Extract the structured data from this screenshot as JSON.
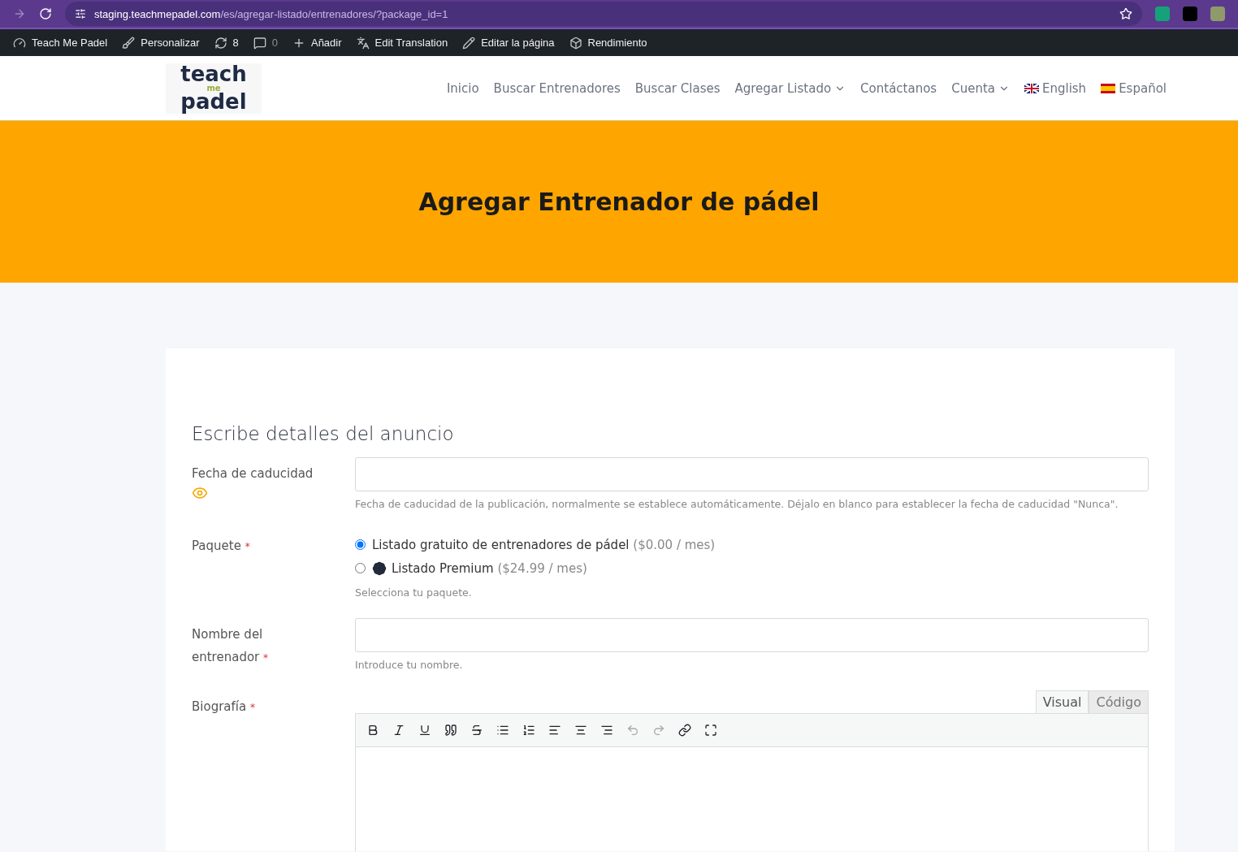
{
  "browser": {
    "url_host": "staging.teachmepadel.com",
    "url_path": "/es/agregar-listado/entrenadores/?package_id=1"
  },
  "admin_bar": [
    {
      "kind": "dashboard",
      "label": "Teach Me Padel"
    },
    {
      "kind": "brush",
      "label": "Personalizar"
    },
    {
      "kind": "updates",
      "label": "8"
    },
    {
      "kind": "comments",
      "label": "0"
    },
    {
      "kind": "add",
      "label": "Añadir"
    },
    {
      "kind": "translate",
      "label": "Edit Translation"
    },
    {
      "kind": "edit",
      "label": "Editar la página"
    },
    {
      "kind": "performance",
      "label": "Rendimiento"
    }
  ],
  "logo": {
    "top": "teach",
    "middle": "me",
    "bottom": "padel"
  },
  "nav": [
    {
      "kind": "link",
      "label": "Inicio",
      "dropdown": false
    },
    {
      "kind": "link",
      "label": "Buscar Entrenadores",
      "dropdown": false
    },
    {
      "kind": "link",
      "label": "Buscar Clases",
      "dropdown": false
    },
    {
      "kind": "link",
      "label": "Agregar Listado",
      "dropdown": true
    },
    {
      "kind": "link",
      "label": "Contáctanos",
      "dropdown": false
    },
    {
      "kind": "link",
      "label": "Cuenta",
      "dropdown": true
    },
    {
      "kind": "uk",
      "label": "English",
      "dropdown": false
    },
    {
      "kind": "es",
      "label": "Español",
      "dropdown": false
    }
  ],
  "hero": {
    "title": "Agregar Entrenador de pádel"
  },
  "form": {
    "title": "Escribe detalles del anuncio",
    "expiry": {
      "label": "Fecha de caducidad",
      "help": "Fecha de caducidad de la publicación, normalmente se establece automáticamente. Déjalo en blanco para establecer la fecha de caducidad \"Nunca\"."
    },
    "package": {
      "label": "Paquete",
      "required_mark": "*",
      "options": [
        {
          "name": "Listado gratuito de entrenadores de pádel",
          "price": "($0.00 / mes)",
          "selected": true,
          "badge": false
        },
        {
          "name": "Listado Premium",
          "price": "($24.99 / mes)",
          "selected": false,
          "badge": true
        }
      ],
      "help": "Selecciona tu paquete."
    },
    "name": {
      "label_1": "Nombre del",
      "label_2": "entrenador",
      "required_mark": "*",
      "help": "Introduce tu nombre."
    },
    "bio": {
      "label": "Biografía",
      "required_mark": "*",
      "tabs": [
        {
          "label": "Visual",
          "selected": true
        },
        {
          "label": "Código",
          "selected": false
        }
      ],
      "tools": [
        {
          "kind": "bold",
          "disabled": false
        },
        {
          "kind": "italic",
          "disabled": false
        },
        {
          "kind": "underline",
          "disabled": false
        },
        {
          "kind": "quote",
          "disabled": false
        },
        {
          "kind": "strike",
          "disabled": false
        },
        {
          "kind": "bullets",
          "disabled": false
        },
        {
          "kind": "numbers",
          "disabled": false
        },
        {
          "kind": "left",
          "disabled": false
        },
        {
          "kind": "center",
          "disabled": false
        },
        {
          "kind": "right",
          "disabled": false
        },
        {
          "kind": "undo",
          "disabled": true
        },
        {
          "kind": "redo",
          "disabled": true
        },
        {
          "kind": "link",
          "disabled": false
        },
        {
          "kind": "fullscreen",
          "disabled": false
        }
      ]
    }
  }
}
